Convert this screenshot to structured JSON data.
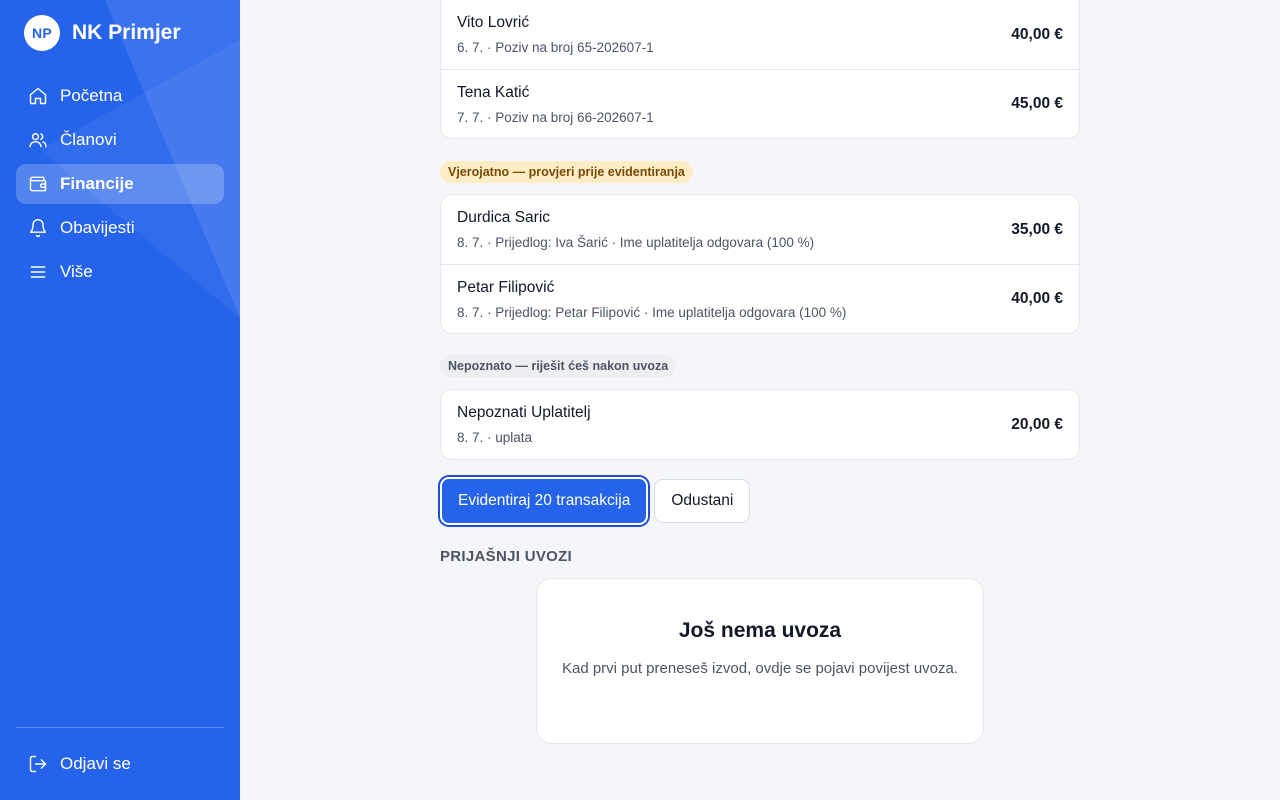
{
  "brand": {
    "initials": "NP",
    "name": "NK Primjer"
  },
  "nav": [
    {
      "label": "Početna",
      "icon": "home-icon"
    },
    {
      "label": "Članovi",
      "icon": "users-icon"
    },
    {
      "label": "Financije",
      "icon": "wallet-icon",
      "active": true
    },
    {
      "label": "Obavijesti",
      "icon": "bell-icon"
    },
    {
      "label": "Više",
      "icon": "menu-icon"
    }
  ],
  "logout": {
    "label": "Odjavi se",
    "icon": "logout-icon"
  },
  "matched": [
    {
      "name": "Vito Lovrić",
      "meta": "6. 7. · Poziv na broj 65-202607-1",
      "amount": "40,00 €"
    },
    {
      "name": "Tena Katić",
      "meta": "7. 7. · Poziv na broj 66-202607-1",
      "amount": "45,00 €"
    }
  ],
  "probable": {
    "badge": "Vjerojatno — provjeri prije evidentiranja",
    "rows": [
      {
        "name": "Durdica Saric",
        "meta": "8. 7. · Prijedlog: Iva Šarić · Ime uplatitelja odgovara (100 %)",
        "amount": "35,00 €"
      },
      {
        "name": "Petar Filipović",
        "meta": "8. 7. · Prijedlog: Petar Filipović · Ime uplatitelja odgovara (100 %)",
        "amount": "40,00 €"
      }
    ]
  },
  "unknown": {
    "badge": "Nepoznato — riješit ćeš nakon uvoza",
    "rows": [
      {
        "name": "Nepoznati Uplatitelj",
        "meta": "8. 7. · uplata",
        "amount": "20,00 €"
      }
    ]
  },
  "actions": {
    "confirm": "Evidentiraj 20 transakcija",
    "cancel": "Odustani"
  },
  "history": {
    "title": "PRIJAŠNJI UVOZI",
    "empty_title": "Još nema uvoza",
    "empty_text": "Kad prvi put preneseš izvod, ovdje se pojavi povijest uvoza."
  },
  "colors": {
    "brand": "#2563eb",
    "warn_badge": "#fdedc4",
    "neutral_badge": "#eceef2"
  }
}
